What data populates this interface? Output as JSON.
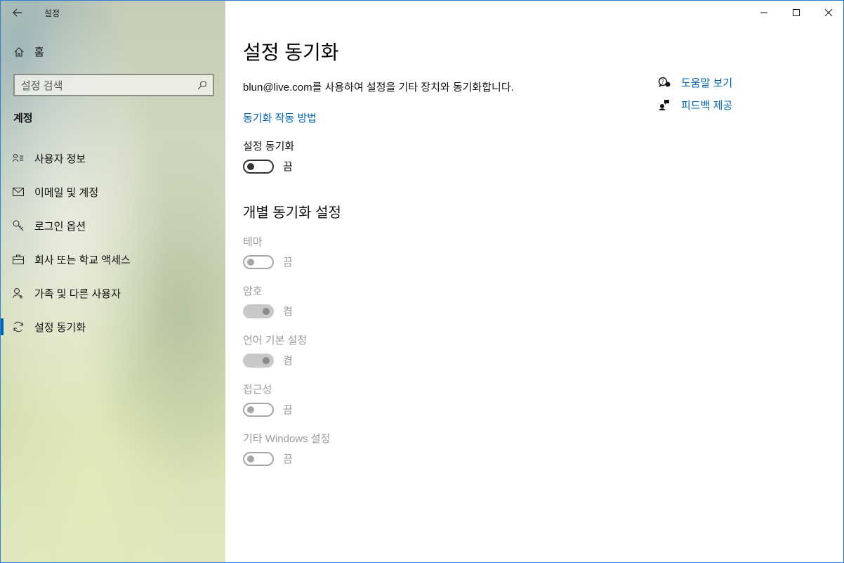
{
  "window": {
    "app_title": "설정"
  },
  "sidebar": {
    "home_label": "홈",
    "search_placeholder": "설정 검색",
    "section_label": "계정",
    "items": [
      {
        "label": "사용자 정보",
        "icon": "user-info-icon"
      },
      {
        "label": "이메일 및 계정",
        "icon": "mail-icon"
      },
      {
        "label": "로그인 옵션",
        "icon": "key-icon"
      },
      {
        "label": "회사 또는 학교 액세스",
        "icon": "briefcase-icon"
      },
      {
        "label": "가족 및 다른 사용자",
        "icon": "person-add-icon"
      },
      {
        "label": "설정 동기화",
        "icon": "sync-icon",
        "selected": true
      }
    ]
  },
  "main": {
    "title": "설정 동기화",
    "description": "blun@live.com를 사용하여 설정을 기타 장치와 동기화합니다.",
    "how_link": "동기화 작동 방법",
    "master_toggle": {
      "label": "설정 동기화",
      "state": "끔",
      "on": false,
      "enabled": true
    },
    "individual_title": "개별 동기화 설정",
    "toggles": [
      {
        "label": "테마",
        "state": "끔",
        "on": false
      },
      {
        "label": "암호",
        "state": "켬",
        "on": true
      },
      {
        "label": "언어 기본 설정",
        "state": "켬",
        "on": true
      },
      {
        "label": "접근성",
        "state": "끔",
        "on": false
      },
      {
        "label": "기타 Windows 설정",
        "state": "끔",
        "on": false
      }
    ]
  },
  "help": {
    "get_help": "도움말 보기",
    "feedback": "피드백 제공"
  },
  "colors": {
    "accent": "#0063b1",
    "disabled_text": "#999999"
  }
}
